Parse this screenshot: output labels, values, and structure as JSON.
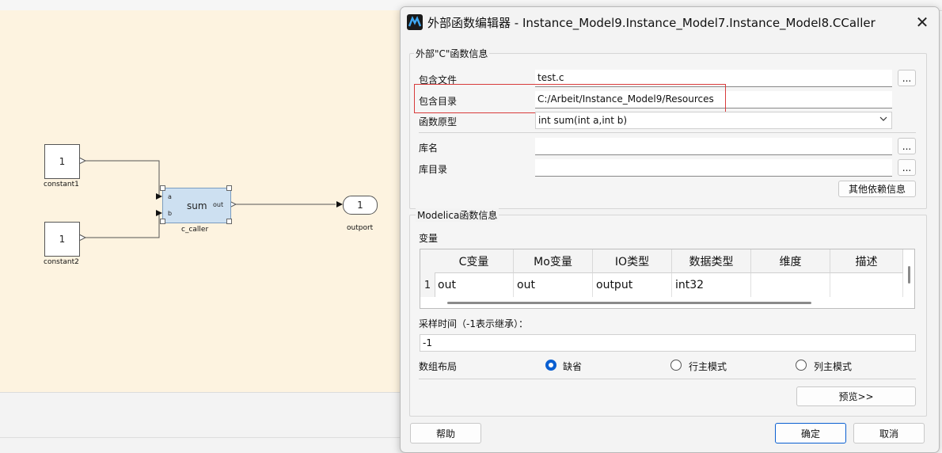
{
  "diagram": {
    "constant1": {
      "value": "1",
      "label": "constant1"
    },
    "constant2": {
      "value": "1",
      "label": "constant2"
    },
    "caller": {
      "text": "sum",
      "port_a": "a",
      "port_b": "b",
      "port_out": "out",
      "label": "c_caller"
    },
    "outport": {
      "value": "1",
      "label": "outport"
    }
  },
  "dialog": {
    "title": "外部函数编辑器 - Instance_Model9.Instance_Model7.Instance_Model8.CCaller",
    "close_icon": "close-icon",
    "c_group": {
      "title": "外部\"C\"函数信息",
      "include_file_label": "包含文件",
      "include_file_value": "test.c",
      "include_dir_label": "包含目录",
      "include_dir_value": "C:/Arbeit/Instance_Model9/Resources",
      "prototype_label": "函数原型",
      "prototype_value": "int sum(int a,int b)",
      "lib_name_label": "库名",
      "lib_name_value": "",
      "lib_dir_label": "库目录",
      "lib_dir_value": "",
      "browse_label": "...",
      "other_deps_label": "其他依赖信息"
    },
    "mo_group": {
      "title": "Modelica函数信息",
      "vars_label": "变量",
      "columns": [
        "C变量",
        "Mo变量",
        "IO类型",
        "数据类型",
        "维度",
        "描述"
      ],
      "rows": [
        {
          "num": "1",
          "cells": [
            "out",
            "out",
            "output",
            "int32",
            "",
            ""
          ]
        }
      ],
      "sample_time_label": "采样时间（-1表示继承）：",
      "sample_time_value": "-1",
      "layout_label": "数组布局",
      "layout_options": [
        "缺省",
        "行主模式",
        "列主模式"
      ],
      "layout_selected": "缺省",
      "preview_label": "预览>>"
    },
    "buttons": {
      "help": "帮助",
      "ok": "确定",
      "cancel": "取消"
    },
    "colors": {
      "highlight": "#d83b3b",
      "radio_on": "#0a5fd1",
      "caller_fill": "#cde0f1",
      "diagram_bg": "#fdf3e0"
    }
  }
}
